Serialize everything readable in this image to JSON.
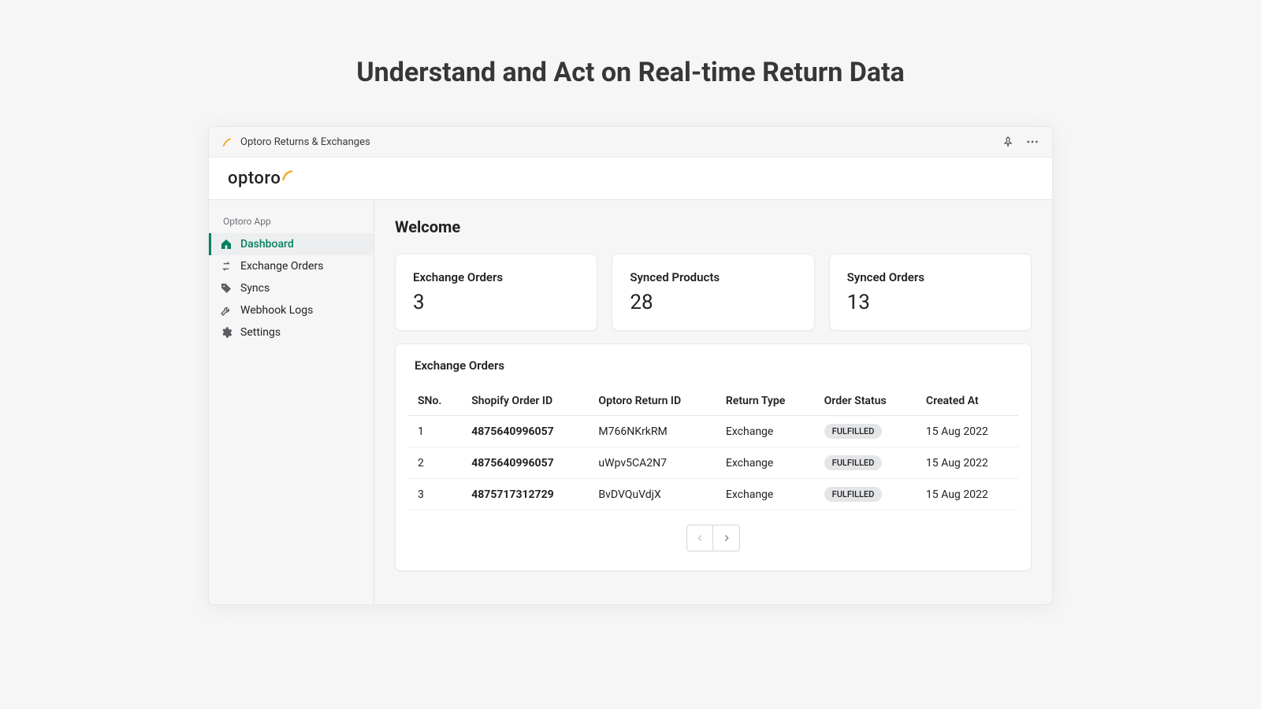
{
  "headline": "Understand and Act on Real-time Return Data",
  "titlebar": {
    "app_name": "Optoro Returns & Exchanges"
  },
  "brand": {
    "name": "optoro"
  },
  "sidebar": {
    "section_label": "Optoro App",
    "items": [
      {
        "label": "Dashboard",
        "icon": "home-icon",
        "active": true
      },
      {
        "label": "Exchange Orders",
        "icon": "exchange-icon",
        "active": false
      },
      {
        "label": "Syncs",
        "icon": "tag-icon",
        "active": false
      },
      {
        "label": "Webhook Logs",
        "icon": "wrench-icon",
        "active": false
      },
      {
        "label": "Settings",
        "icon": "gear-icon",
        "active": false
      }
    ]
  },
  "main": {
    "welcome": "Welcome",
    "cards": [
      {
        "title": "Exchange Orders",
        "value": "3"
      },
      {
        "title": "Synced Products",
        "value": "28"
      },
      {
        "title": "Synced Orders",
        "value": "13"
      }
    ],
    "table": {
      "title": "Exchange Orders",
      "columns": [
        "SNo.",
        "Shopify Order ID",
        "Optoro Return ID",
        "Return Type",
        "Order Status",
        "Created At"
      ],
      "rows": [
        {
          "sno": "1",
          "shopify_id": "4875640996057",
          "return_id": "M766NKrkRM",
          "type": "Exchange",
          "status": "FULFILLED",
          "created": "15 Aug 2022"
        },
        {
          "sno": "2",
          "shopify_id": "4875640996057",
          "return_id": "uWpv5CA2N7",
          "type": "Exchange",
          "status": "FULFILLED",
          "created": "15 Aug 2022"
        },
        {
          "sno": "3",
          "shopify_id": "4875717312729",
          "return_id": "BvDVQuVdjX",
          "type": "Exchange",
          "status": "FULFILLED",
          "created": "15 Aug 2022"
        }
      ]
    }
  }
}
